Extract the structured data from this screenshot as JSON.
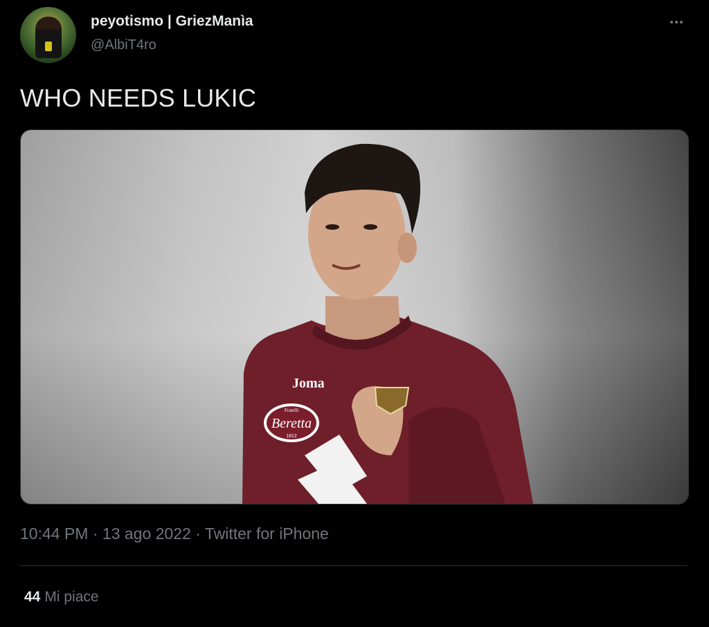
{
  "tweet": {
    "display_name": "peyotismo | GriezManìa",
    "handle": "@AlbiT4ro",
    "text": "WHO NEEDS LUKIC",
    "time": "10:44 PM",
    "date": "13 ago 2022",
    "source": "Twitter for iPhone",
    "separator": " · ",
    "likes_count": "44",
    "likes_label": "Mi piace"
  },
  "media": {
    "jersey_sponsor_top": "Joma",
    "jersey_sponsor_main": "Beretta",
    "jersey_sponsor_small": "Fratelli",
    "jersey_sponsor_year": "1812"
  },
  "icons": {
    "more": "more-horizontal-icon"
  },
  "colors": {
    "background": "#000000",
    "text_primary": "#e7e9ea",
    "text_secondary": "#71767b",
    "divider": "#2f3336",
    "jersey": "#6e1f2a"
  }
}
